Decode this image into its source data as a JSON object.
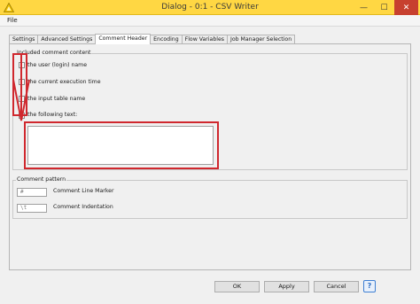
{
  "window": {
    "title": "Dialog - 0:1 - CSV Writer",
    "minimize_glyph": "—",
    "maximize_glyph": "☐",
    "close_glyph": "✕",
    "icon": "knime-triangle-icon"
  },
  "menubar": {
    "file_label": "File"
  },
  "tabs": [
    {
      "label": "Settings",
      "active": false
    },
    {
      "label": "Advanced Settings",
      "active": false
    },
    {
      "label": "Comment Header",
      "active": true
    },
    {
      "label": "Encoding",
      "active": false
    },
    {
      "label": "Flow Variables",
      "active": false
    },
    {
      "label": "Job Manager Selection",
      "active": false
    }
  ],
  "included_comment": {
    "title": "Included comment content",
    "options": [
      {
        "label": "the user (login) name",
        "checked": false
      },
      {
        "label": "the current execution time",
        "checked": false
      },
      {
        "label": "the input table name",
        "checked": false
      },
      {
        "label": "the following text:",
        "checked": false
      }
    ],
    "text_value": ""
  },
  "comment_pattern": {
    "title": "Comment pattern",
    "line_marker_value": "#",
    "line_marker_label": "Comment Line Marker",
    "indentation_value": "\\t",
    "indentation_label": "Comment Indentation"
  },
  "buttons": {
    "ok": "OK",
    "apply": "Apply",
    "cancel": "Cancel",
    "help": "?"
  },
  "colors": {
    "titlebar": "#ffd743",
    "close_button": "#c7402f",
    "annotation": "#d0282e",
    "help_accent": "#3f7fd3"
  }
}
